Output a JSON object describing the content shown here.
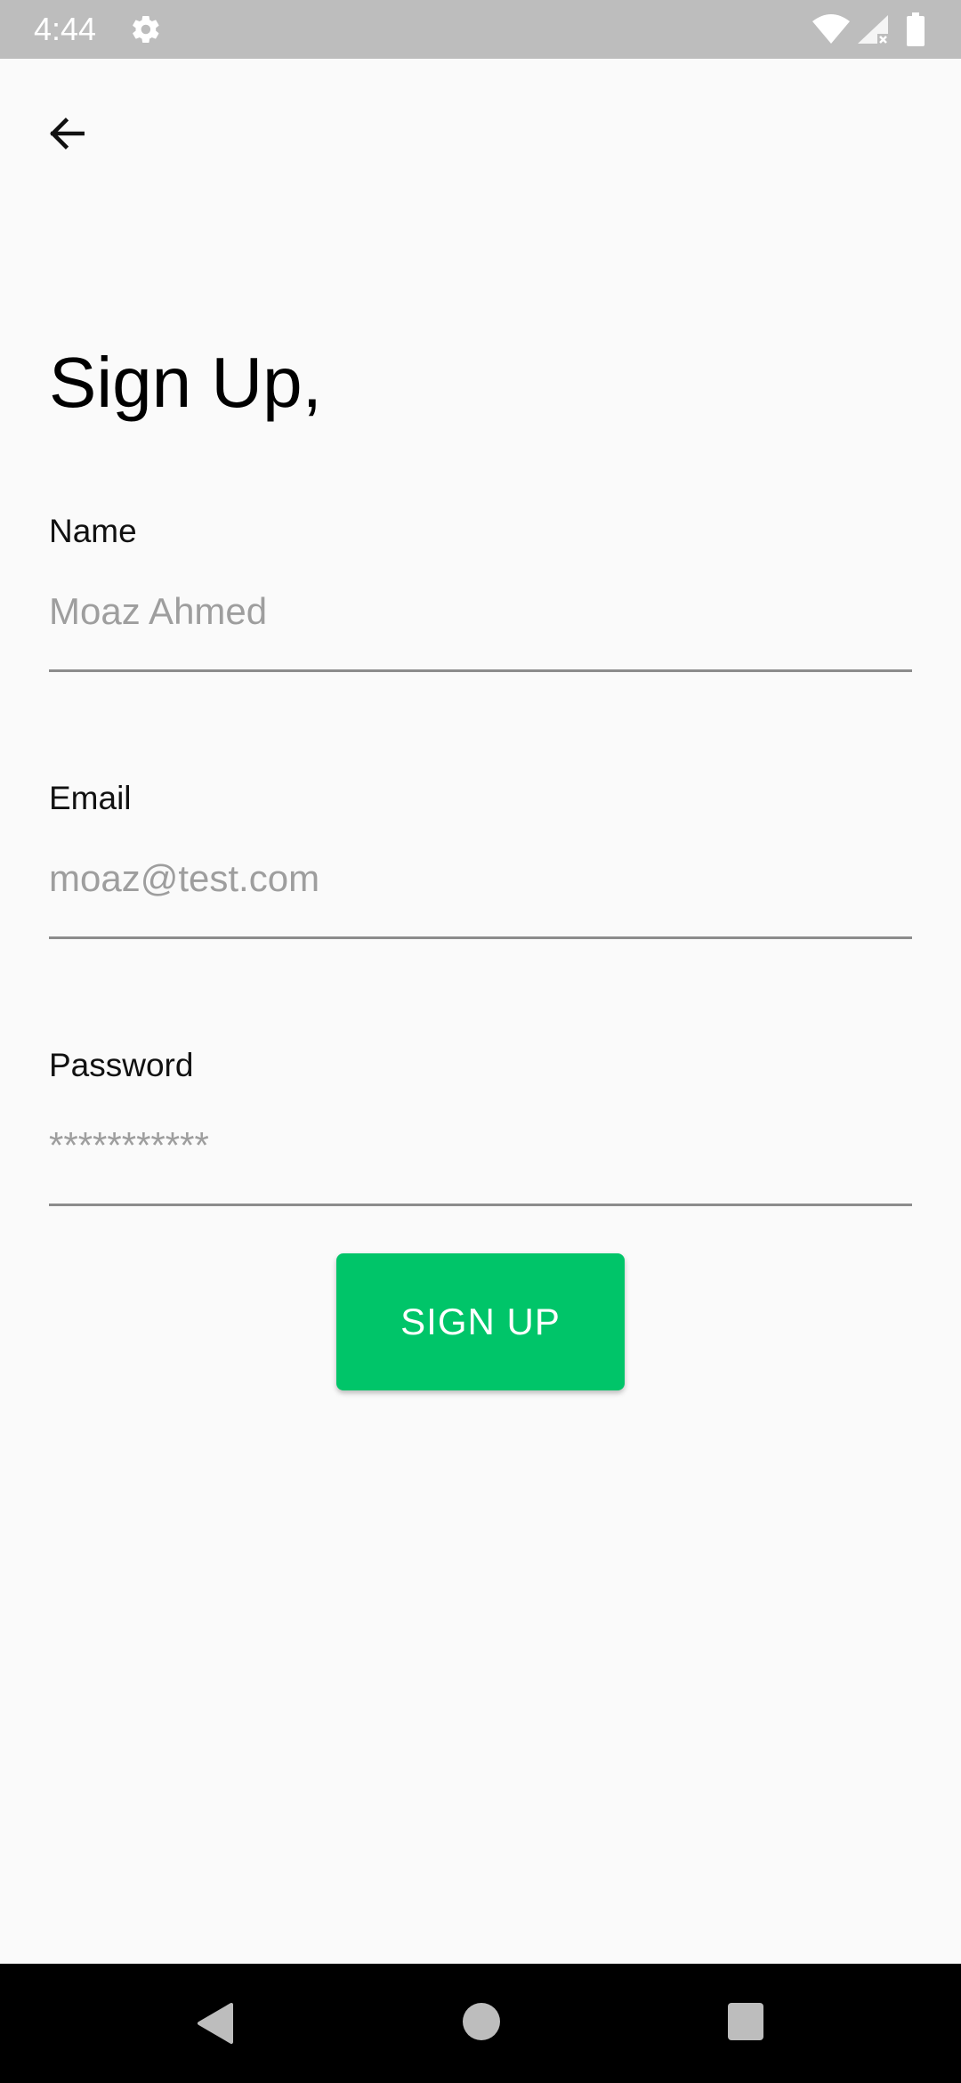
{
  "status_bar": {
    "time": "4:44"
  },
  "header": {
    "title": "Sign Up,"
  },
  "form": {
    "name": {
      "label": "Name",
      "value": "Moaz Ahmed"
    },
    "email": {
      "label": "Email",
      "value": "moaz@test.com"
    },
    "password": {
      "label": "Password",
      "value": "***********"
    },
    "submit_label": "SIGN UP"
  },
  "colors": {
    "accent": "#00c569",
    "status_bar": "#bdbdbd",
    "background": "#fafafa"
  },
  "icons": {
    "status": [
      "gear-icon",
      "wifi-icon",
      "signal-icon",
      "battery-icon"
    ],
    "app_bar": [
      "arrow-back-icon"
    ],
    "nav": [
      "nav-back-icon",
      "nav-home-icon",
      "nav-recents-icon"
    ]
  }
}
